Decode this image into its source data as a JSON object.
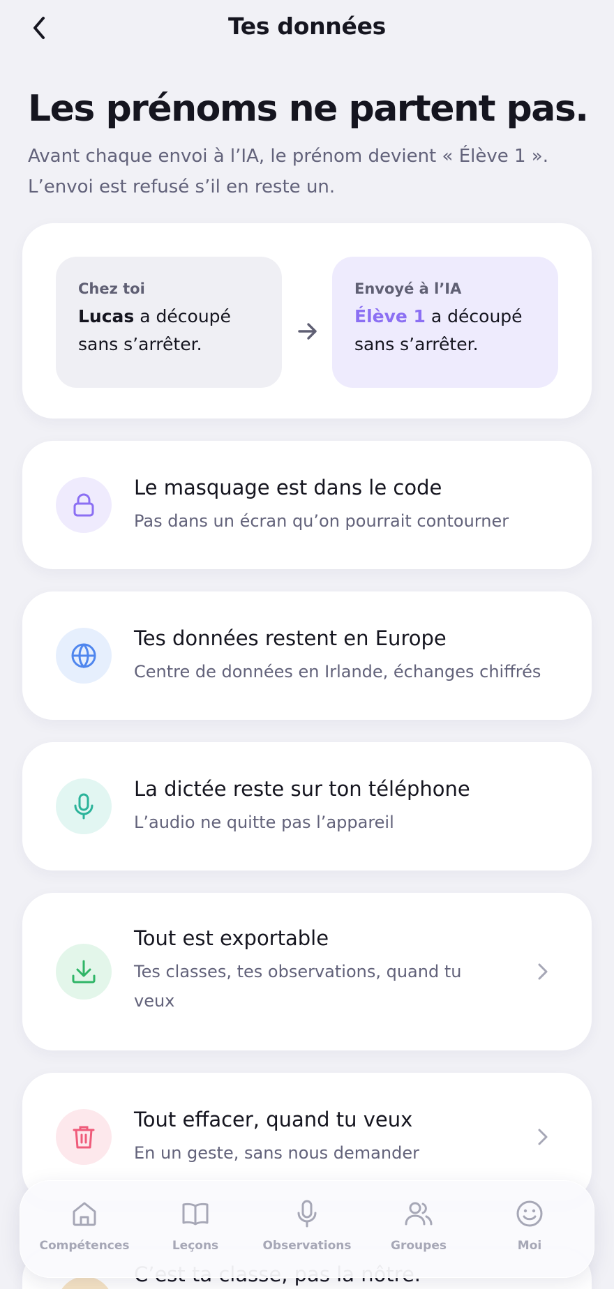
{
  "header": {
    "title": "Tes données",
    "back_icon": "chevron-left-icon"
  },
  "hero": {
    "title": "Les prénoms ne partent pas.",
    "subtitle_line1": "Avant chaque envoi à l’IA, le prénom devient « Élève 1 ».",
    "subtitle_line2": "L’envoi est refusé s’il en reste un."
  },
  "comparison": {
    "left": {
      "label": "Chez toi",
      "name": "Lucas",
      "text_rest": " a découpé sans s’arrêter."
    },
    "arrow_icon": "arrow-right-icon",
    "right": {
      "label": "Envoyé à l’IA",
      "name": "Élève 1",
      "text_rest": " a découpé sans s’arrêter."
    },
    "accent_color": "#8b6ff3"
  },
  "features": [
    {
      "title": "Le masquage est dans le code",
      "subtitle": "Pas dans un écran qu’on pourrait contourner",
      "icon": "lock-icon",
      "icon_color": "#8b6ff3",
      "icon_bg": "#efebfd",
      "has_chevron": false
    },
    {
      "title": "Tes données restent en Europe",
      "subtitle": "Centre de données en Irlande, échanges chiffrés",
      "icon": "globe-icon",
      "icon_color": "#4f86ee",
      "icon_bg": "#e6effd",
      "has_chevron": false
    },
    {
      "title": "La dictée reste sur ton téléphone",
      "subtitle": "L’audio ne quitte pas l’appareil",
      "icon": "microphone-icon",
      "icon_color": "#2bb39a",
      "icon_bg": "#e2f6f2",
      "has_chevron": false
    },
    {
      "title": "Tout est exportable",
      "subtitle": "Tes classes, tes observations, quand tu veux",
      "icon": "download-icon",
      "icon_color": "#2fb567",
      "icon_bg": "#e3f6ea",
      "has_chevron": true
    },
    {
      "title": "Tout effacer, quand tu veux",
      "subtitle": "En un geste, sans nous demander",
      "icon": "trash-icon",
      "icon_color": "#ef5b7a",
      "icon_bg": "#fde8ec",
      "has_chevron": true
    }
  ],
  "peek": {
    "title": "C’est ta classe, pas la nôtre."
  },
  "tabbar": {
    "items": [
      {
        "label": "Compétences",
        "icon": "home-icon"
      },
      {
        "label": "Leçons",
        "icon": "book-icon"
      },
      {
        "label": "Observations",
        "icon": "microphone-icon"
      },
      {
        "label": "Groupes",
        "icon": "users-icon"
      },
      {
        "label": "Moi",
        "icon": "smiley-icon"
      }
    ]
  }
}
